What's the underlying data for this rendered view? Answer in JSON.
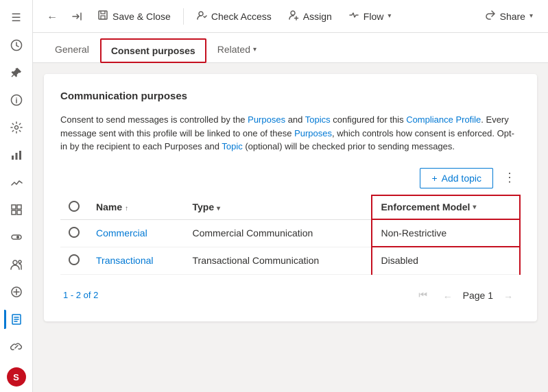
{
  "sidebar": {
    "avatar_label": "S",
    "icons": [
      {
        "name": "hamburger-menu-icon",
        "symbol": "☰"
      },
      {
        "name": "recent-icon",
        "symbol": "🕐"
      },
      {
        "name": "pin-icon",
        "symbol": "📌"
      },
      {
        "name": "info-icon",
        "symbol": "ℹ"
      },
      {
        "name": "settings-icon",
        "symbol": "⚙"
      },
      {
        "name": "analytics-icon",
        "symbol": "📊"
      },
      {
        "name": "chart-icon",
        "symbol": "📈"
      },
      {
        "name": "grid-icon",
        "symbol": "⊞"
      },
      {
        "name": "toggle-icon",
        "symbol": "⊙"
      },
      {
        "name": "users-icon",
        "symbol": "👥"
      },
      {
        "name": "groups-icon",
        "symbol": "⊕"
      },
      {
        "name": "active-icon",
        "symbol": "📋"
      },
      {
        "name": "link-icon",
        "symbol": "🔗"
      }
    ]
  },
  "toolbar": {
    "back_label": "←",
    "forward_label": "↻",
    "save_close_label": "Save & Close",
    "check_access_label": "Check Access",
    "assign_label": "Assign",
    "flow_label": "Flow",
    "share_label": "Share",
    "save_icon": "💾",
    "check_access_icon": "👤",
    "assign_icon": "👤",
    "flow_icon": "⇒",
    "share_icon": "↗"
  },
  "tabs": {
    "general_label": "General",
    "consent_purposes_label": "Consent purposes",
    "related_label": "Related"
  },
  "card": {
    "section_title": "Communication purposes",
    "info_text_parts": [
      "Consent to send messages is controlled by the Purposes and Topics configured for this Compliance Profile. Every message sent with this profile will be linked to one of these Purposes, which controls how consent is enforced. Opt-in by the recipient to each Purposes and Topic (optional) will be checked prior to sending messages."
    ],
    "info_links": [
      "Purposes",
      "Topics",
      "Compliance Profile",
      "Purposes",
      "Topic"
    ],
    "add_topic_label": "Add topic",
    "more_options_symbol": "⋮"
  },
  "table": {
    "columns": [
      {
        "key": "radio",
        "label": "",
        "sortable": false
      },
      {
        "key": "name",
        "label": "Name",
        "sortable": true
      },
      {
        "key": "type",
        "label": "Type",
        "filterable": true
      },
      {
        "key": "enforcement",
        "label": "Enforcement Model",
        "filterable": true,
        "highlighted": true
      }
    ],
    "rows": [
      {
        "name": "Commercial",
        "type": "Commercial Communication",
        "enforcement": "Non-Restrictive"
      },
      {
        "name": "Transactional",
        "type": "Transactional Communication",
        "enforcement": "Disabled"
      }
    ]
  },
  "pagination": {
    "count_label": "1 - 2 of 2",
    "page_label": "Page 1",
    "first_icon": "⏮",
    "prev_icon": "←",
    "next_icon": "→"
  }
}
